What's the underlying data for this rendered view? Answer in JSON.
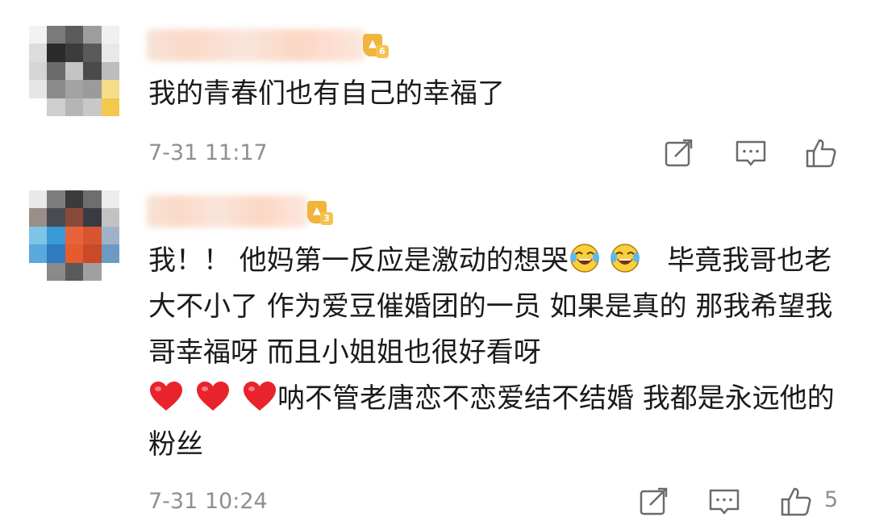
{
  "comments": [
    {
      "text": "我的青春们也有自己的幸福了",
      "level": "6",
      "timestamp": "7-31 11:17",
      "like_count": ""
    },
    {
      "text_parts": [
        "我！！ 他妈第一反应是激动的想哭",
        "   毕竟我哥也老大不小了 作为爱豆催婚团的一员 如果是真的 那我希望我哥幸福呀 而且小姐姐也很好看呀",
        "呐不管老唐恋不恋爱结不结婚 我都是永远他的粉丝"
      ],
      "level": "3",
      "timestamp": "7-31 10:24",
      "like_count": "5"
    }
  ],
  "icons": {
    "share": "share-icon",
    "reply": "comment-icon",
    "like": "thumbs-up-icon",
    "emoji_cry_laugh": "crying-laughing-emoji",
    "emoji_heart": "red-heart-emoji"
  },
  "colors": {
    "text": "#1a1a1a",
    "meta": "#8f8f8f",
    "icon": "#6b6b6b",
    "badge": "#f1b43c",
    "heart": "#e8232c"
  }
}
